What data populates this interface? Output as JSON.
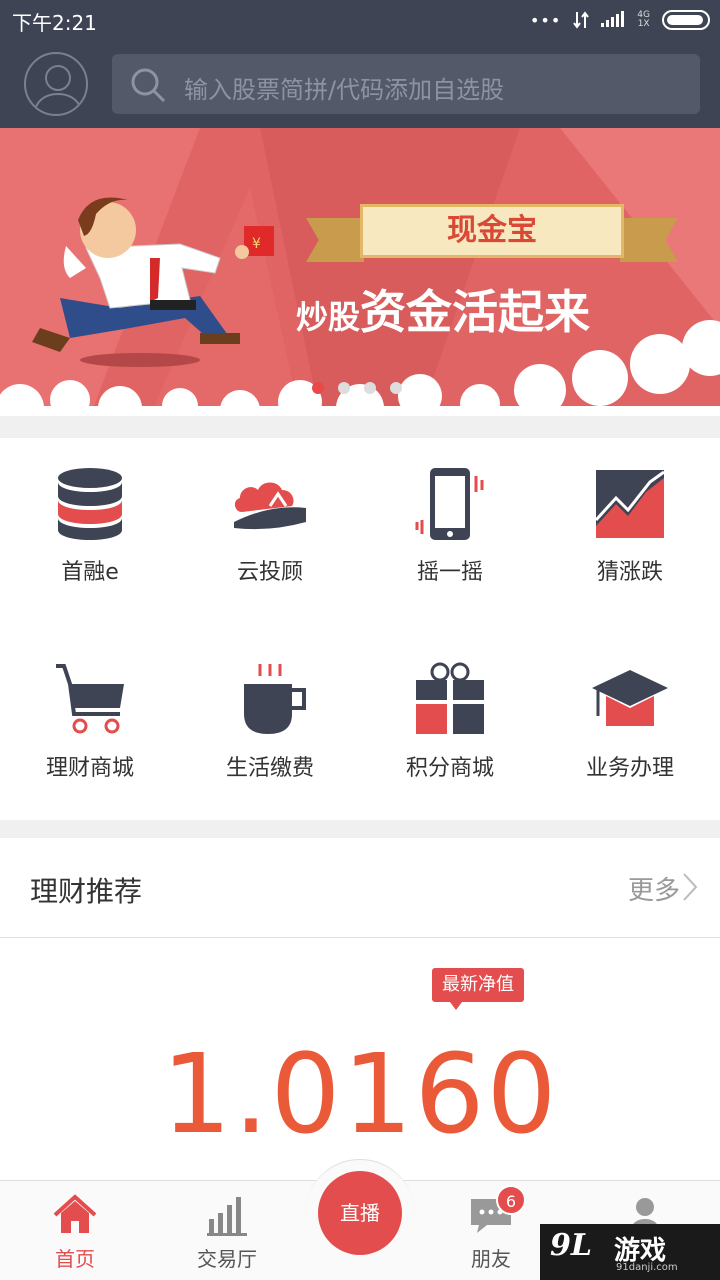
{
  "status_bar": {
    "time": "下午2:21",
    "network": [
      "4G",
      "1X"
    ]
  },
  "header": {
    "search_placeholder": "输入股票简拼/代码添加自选股"
  },
  "banner": {
    "tag": "现金宝",
    "slogan_part1": "炒股",
    "slogan_part2": "资金活起来",
    "slides_total": 4,
    "active_slide": 1
  },
  "grid": {
    "items": [
      {
        "label": "首融e",
        "icon": "database-icon"
      },
      {
        "label": "云投顾",
        "icon": "cloud-icon"
      },
      {
        "label": "摇一摇",
        "icon": "shake-phone-icon"
      },
      {
        "label": "猜涨跌",
        "icon": "trend-chart-icon"
      },
      {
        "label": "理财商城",
        "icon": "shopping-cart-icon"
      },
      {
        "label": "生活缴费",
        "icon": "coffee-cup-icon"
      },
      {
        "label": "积分商城",
        "icon": "gift-icon"
      },
      {
        "label": "业务办理",
        "icon": "graduation-cap-icon"
      }
    ]
  },
  "recommend": {
    "title": "理财推荐",
    "more": "更多",
    "badge": "最新净值",
    "value": "1.0160"
  },
  "tabbar": {
    "items": [
      {
        "label": "首页",
        "icon": "home-icon",
        "active": true
      },
      {
        "label": "交易厅",
        "icon": "bar-chart-icon",
        "active": false
      },
      {
        "label": "直播",
        "icon": "live-icon",
        "active": false
      },
      {
        "label": "朋友",
        "icon": "chat-icon",
        "active": false,
        "badge": "6"
      },
      {
        "label": "",
        "icon": "person-icon",
        "active": false
      }
    ]
  },
  "watermark": {
    "logo": "9L",
    "brand": "游戏",
    "site": "91danji.com"
  },
  "colors": {
    "header": "#3e4453",
    "accent": "#e34d4d",
    "value": "#ea5a38",
    "banner": "#e06464"
  }
}
